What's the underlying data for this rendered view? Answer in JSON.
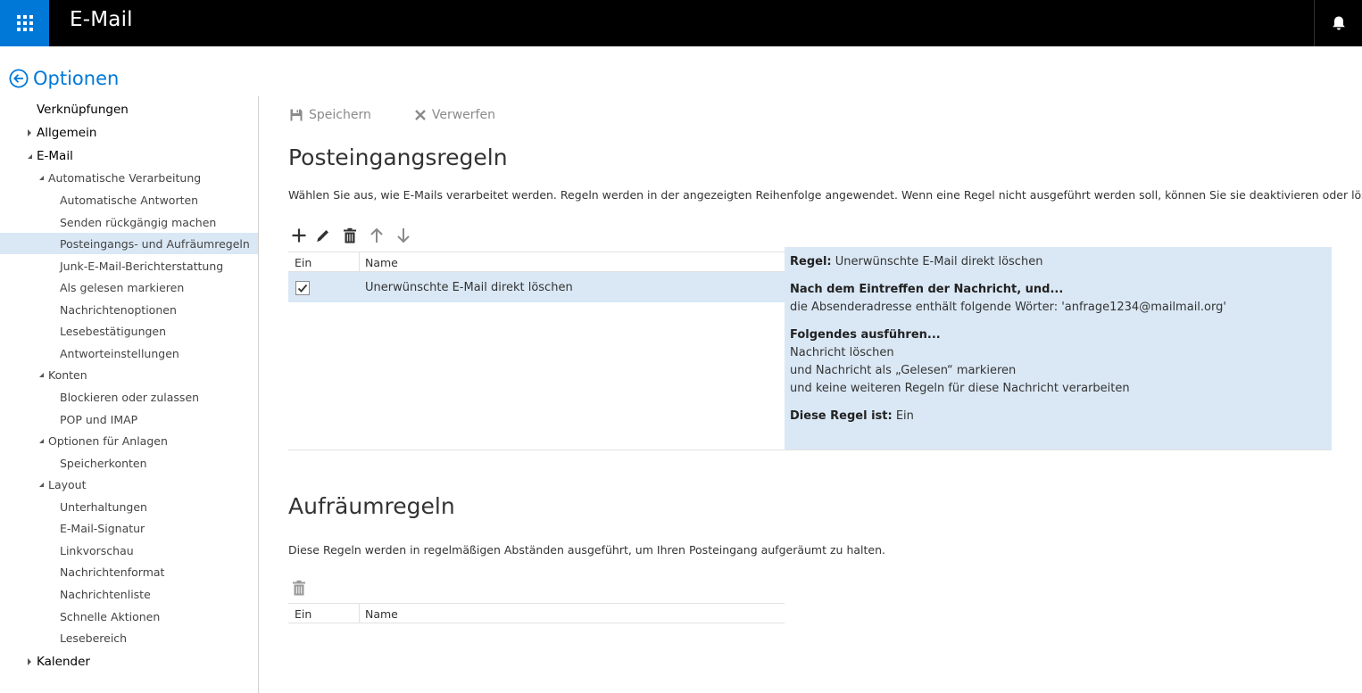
{
  "app": {
    "title": "E-Mail"
  },
  "options": {
    "title": "Optionen"
  },
  "nav": {
    "items": [
      {
        "label": "Verknüpfungen"
      },
      {
        "label": "Allgemein"
      },
      {
        "label": "E-Mail"
      },
      {
        "label": "Automatische Verarbeitung"
      },
      {
        "label": "Automatische Antworten"
      },
      {
        "label": "Senden rückgängig machen"
      },
      {
        "label": "Posteingangs- und Aufräumregeln"
      },
      {
        "label": "Junk-E-Mail-Berichterstattung"
      },
      {
        "label": "Als gelesen markieren"
      },
      {
        "label": "Nachrichtenoptionen"
      },
      {
        "label": "Lesebestätigungen"
      },
      {
        "label": "Antworteinstellungen"
      },
      {
        "label": "Konten"
      },
      {
        "label": "Blockieren oder zulassen"
      },
      {
        "label": "POP und IMAP"
      },
      {
        "label": "Optionen für Anlagen"
      },
      {
        "label": "Speicherkonten"
      },
      {
        "label": "Layout"
      },
      {
        "label": "Unterhaltungen"
      },
      {
        "label": "E-Mail-Signatur"
      },
      {
        "label": "Linkvorschau"
      },
      {
        "label": "Nachrichtenformat"
      },
      {
        "label": "Nachrichtenliste"
      },
      {
        "label": "Schnelle Aktionen"
      },
      {
        "label": "Lesebereich"
      },
      {
        "label": "Kalender"
      }
    ]
  },
  "commands": {
    "save": "Speichern",
    "discard": "Verwerfen"
  },
  "inbox_rules": {
    "title": "Posteingangsregeln",
    "description": "Wählen Sie aus, wie E-Mails verarbeitet werden. Regeln werden in der angezeigten Reihenfolge angewendet. Wenn eine Regel nicht ausgeführt werden soll, können Sie sie deaktivieren oder löschen.",
    "columns": {
      "on": "Ein",
      "name": "Name"
    },
    "rows": [
      {
        "name": "Unerwünschte E-Mail direkt löschen",
        "enabled": true
      }
    ],
    "detail": {
      "rule_label": "Regel:",
      "rule_value": "Unerwünschte E-Mail direkt löschen",
      "condition_heading": "Nach dem Eintreffen der Nachricht, und...",
      "condition_text": "die Absenderadresse enthält folgende Wörter: 'anfrage1234@mailmail.org'",
      "actions_heading": "Folgendes ausführen...",
      "action_1": "Nachricht löschen",
      "action_2": "und Nachricht als „Gelesen“ markieren",
      "action_3": "und keine weiteren Regeln für diese Nachricht verarbeiten",
      "status_label": "Diese Regel ist:",
      "status_value": "Ein"
    }
  },
  "sweep_rules": {
    "title": "Aufräumregeln",
    "description": "Diese Regeln werden in regelmäßigen Abständen ausgeführt, um Ihren Posteingang aufgeräumt zu halten.",
    "columns": {
      "on": "Ein",
      "name": "Name"
    }
  },
  "colors": {
    "accent": "#0078d7",
    "selected": "#dae8f5",
    "topbar": "#000000"
  }
}
